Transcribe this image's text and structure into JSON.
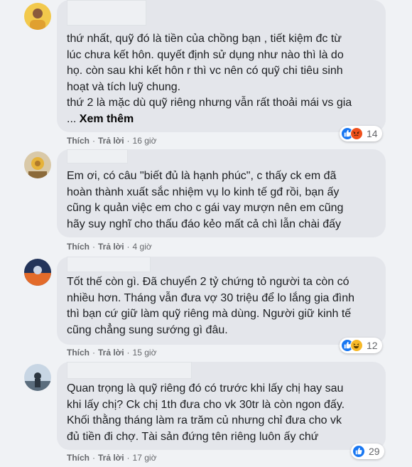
{
  "comments": [
    {
      "lines": [
        "thứ nhất, quỹ đó là tiền của chồng bạn , tiết kiệm đc từ",
        "lúc chưa kết hôn. quyết định sử dụng như nào thì là do",
        "họ. còn sau khi kết hôn r thì vc nên có quỹ chi tiêu sinh",
        "hoạt và tích luỹ chung.",
        "thứ 2 là mặc dù quỹ riêng nhưng vẫn rất thoải mái vs gia",
        "..."
      ],
      "see_more": "Xem thêm",
      "like": "Thích",
      "reply": "Trả lời",
      "time": "16 giờ",
      "reaction_icons": [
        "like-icon",
        "angry-icon"
      ],
      "reaction_count": "14"
    },
    {
      "lines": [
        "Em ơi, có câu \"biết đủ là hạnh phúc\", c thấy ck em đã",
        "hoàn thành xuất sắc nhiệm vụ lo kinh tế gđ rồi, bạn ấy",
        "cũng k quản việc em cho c gái vay mượn nên em cũng",
        "hãy suy nghĩ cho thấu đáo kẻo mất cả chì lẫn chài đấy"
      ],
      "like": "Thích",
      "reply": "Trả lời",
      "time": "4 giờ"
    },
    {
      "lines": [
        "Tốt thế còn gì. Đã chuyển 2 tỷ chứng tỏ người ta còn có",
        "nhiều hơn. Tháng vẫn đưa vợ 30 triệu để lo lắng gia đình",
        "thì bạn cứ giữ làm quỹ riêng mà dùng. Người giữ kinh tế",
        "cũng chẳng sung sướng gì đâu."
      ],
      "like": "Thích",
      "reply": "Trả lời",
      "time": "15 giờ",
      "reaction_icons": [
        "like-icon",
        "haha-icon"
      ],
      "reaction_count": "12"
    },
    {
      "lines": [
        "Quan trọng là quỹ riêng đó có trước khi lấy chị hay sau",
        "khi lấy chị? Ck chị 1th đưa cho vk 30tr là còn ngon đấy.",
        "Khối thằng tháng làm ra trăm củ nhưng chỉ đưa cho vk",
        "đủ tiền đi chợ. Tài sản đứng tên riêng luôn ấy chứ"
      ],
      "like": "Thích",
      "reply": "Trả lời",
      "time": "17 giờ",
      "reaction_icons": [
        "like-icon"
      ],
      "reaction_count": "29"
    }
  ],
  "colors": {
    "background": "#f0f2f5",
    "bubble": "#e4e6eb",
    "meta_text": "#65676b",
    "like_blue": "#1877f2",
    "angry_orange": "#f0501c",
    "haha_yellow": "#f7b928"
  }
}
